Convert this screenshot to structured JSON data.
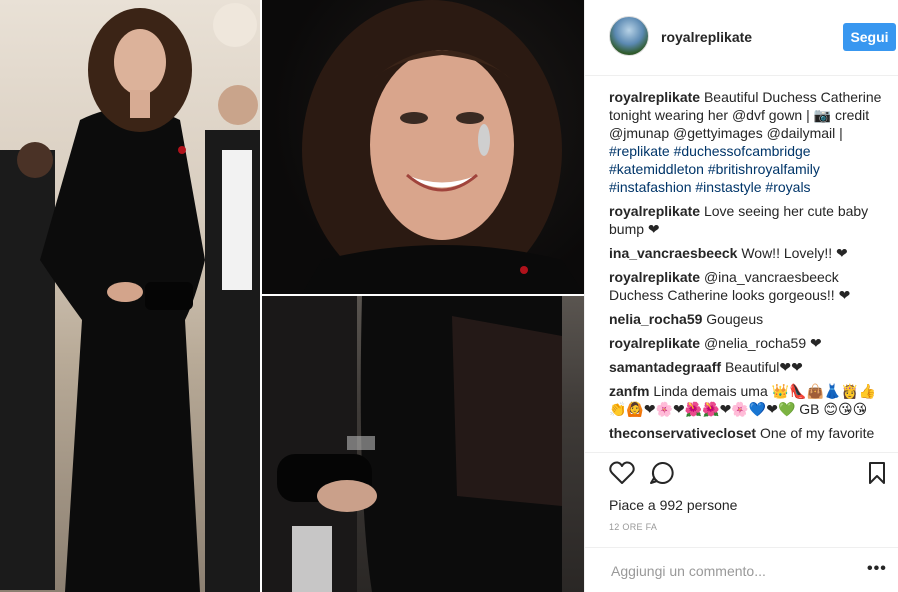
{
  "post": {
    "username": "royalreplikate",
    "follow_label": "Segui",
    "likes_text": "Piace a 992 persone",
    "time_ago": "12 ORE FA",
    "add_comment_placeholder": "Aggiungi un commento...",
    "more_label": "•••"
  },
  "caption": {
    "user": "royalreplikate",
    "text": "Beautiful Duchess Catherine tonight wearing her @dvf gown | 📷 credit @jmunap @gettyimages @dailymail |",
    "tags": "#replikate #duchessofcambridge #katemiddleton #britishroyalfamily #instafashion #instastyle #royals"
  },
  "comments": [
    {
      "user": "royalreplikate",
      "text": "Love seeing her cute baby bump ❤"
    },
    {
      "user": "ina_vancraesbeeck",
      "text": "Wow!! Lovely!! ❤"
    },
    {
      "user": "royalreplikate",
      "text": "@ina_vancraesbeeck Duchess Catherine looks gorgeous!! ❤"
    },
    {
      "user": "nelia_rocha59",
      "text": "Gougeus"
    },
    {
      "user": "royalreplikate",
      "text": "@nelia_rocha59 ❤"
    },
    {
      "user": "samantadegraaff",
      "text": "Beautiful❤❤"
    },
    {
      "user": "zanfm",
      "text": "Linda demais uma 👑👠👜👗👸👍👏🙆❤🌸❤🌺🌺❤🌸💙❤💚 GB 😊😘😘"
    },
    {
      "user": "theconservativecloset",
      "text": "One of my favorite"
    }
  ],
  "icons": {
    "like": "heart-outline-icon",
    "comment": "speech-bubble-icon",
    "save": "bookmark-icon"
  }
}
